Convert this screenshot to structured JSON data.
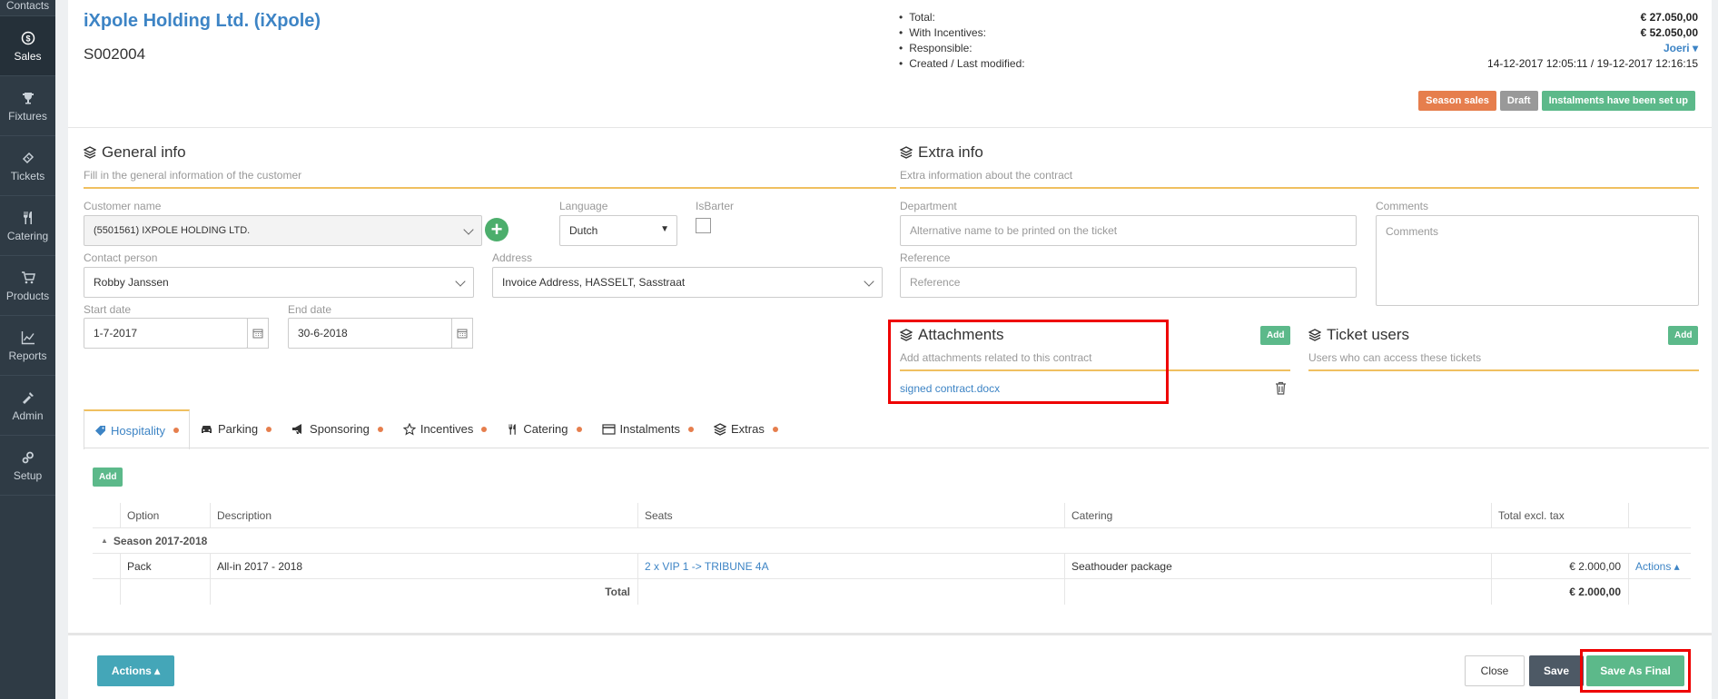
{
  "sidebar": {
    "items": [
      {
        "label": "Contacts"
      },
      {
        "label": "Sales"
      },
      {
        "label": "Fixtures"
      },
      {
        "label": "Tickets"
      },
      {
        "label": "Catering"
      },
      {
        "label": "Products"
      },
      {
        "label": "Reports"
      },
      {
        "label": "Admin"
      },
      {
        "label": "Setup"
      }
    ]
  },
  "header": {
    "title": "iXpole Holding Ltd. (iXpole)",
    "code": "S002004"
  },
  "summary": {
    "total_label": "Total:",
    "total_value": "€ 27.050,00",
    "incentives_label": "With Incentives:",
    "incentives_value": "€ 52.050,00",
    "responsible_label": "Responsible:",
    "responsible_value": "Joeri ▾",
    "created_label": "Created / Last modified:",
    "created_value": "14-12-2017 12:05:11 / 19-12-2017 12:16:15"
  },
  "badges": {
    "season": "Season sales",
    "draft": "Draft",
    "instalments": "Instalments have been set up"
  },
  "general": {
    "title": "General info",
    "subtitle": "Fill in the general information of the customer",
    "customer_label": "Customer name",
    "customer_value": "(5501561) IXPOLE HOLDING LTD.",
    "language_label": "Language",
    "language_value": "Dutch",
    "isbarter_label": "IsBarter",
    "contact_label": "Contact person",
    "contact_value": "Robby Janssen",
    "address_label": "Address",
    "address_value": "Invoice Address, HASSELT, Sasstraat",
    "start_label": "Start date",
    "start_value": "1-7-2017",
    "end_label": "End date",
    "end_value": "30-6-2018"
  },
  "extra": {
    "title": "Extra info",
    "subtitle": "Extra information about the contract",
    "department_label": "Department",
    "department_placeholder": "Alternative name to be printed on the ticket",
    "comments_label": "Comments",
    "comments_placeholder": "Comments",
    "reference_label": "Reference",
    "reference_placeholder": "Reference"
  },
  "attachments": {
    "title": "Attachments",
    "subtitle": "Add attachments related to this contract",
    "add": "Add",
    "file": "signed contract.docx"
  },
  "ticket_users": {
    "title": "Ticket users",
    "subtitle": "Users who can access these tickets",
    "add": "Add"
  },
  "tabs": [
    {
      "label": "Hospitality"
    },
    {
      "label": "Parking"
    },
    {
      "label": "Sponsoring"
    },
    {
      "label": "Incentives"
    },
    {
      "label": "Catering"
    },
    {
      "label": "Instalments"
    },
    {
      "label": "Extras"
    }
  ],
  "hospitality": {
    "add": "Add",
    "headers": [
      "Option",
      "Description",
      "Seats",
      "Catering",
      "Total excl. tax"
    ],
    "group": "Season 2017-2018",
    "row": {
      "option": "Pack",
      "description": "All-in 2017 - 2018",
      "seats": "2 x VIP 1 -> TRIBUNE 4A",
      "catering": "Seathouder package",
      "total": "€ 2.000,00",
      "actions": "Actions ▴"
    },
    "total_label": "Total",
    "total_value": "€ 2.000,00"
  },
  "footer": {
    "actions": "Actions ▴",
    "close": "Close",
    "save": "Save",
    "save_final": "Save As Final"
  }
}
